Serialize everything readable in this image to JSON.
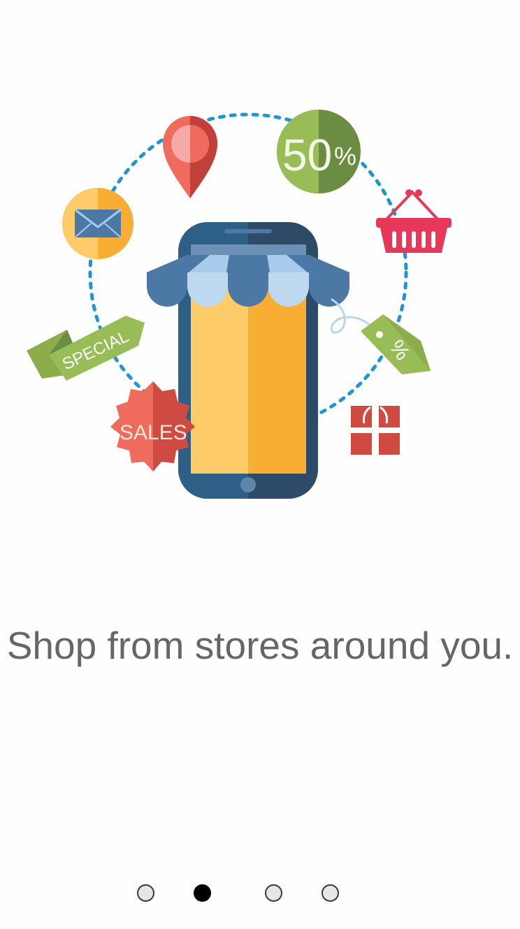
{
  "onboarding": {
    "tagline": "Shop from stores around you.",
    "illustration": {
      "discount_badge": "50",
      "discount_symbol": "%",
      "special_ribbon": "SPECIAL",
      "sales_badge": "SALES",
      "price_tag": "%"
    },
    "pager": {
      "total_pages": 4,
      "active_page": 2
    }
  }
}
